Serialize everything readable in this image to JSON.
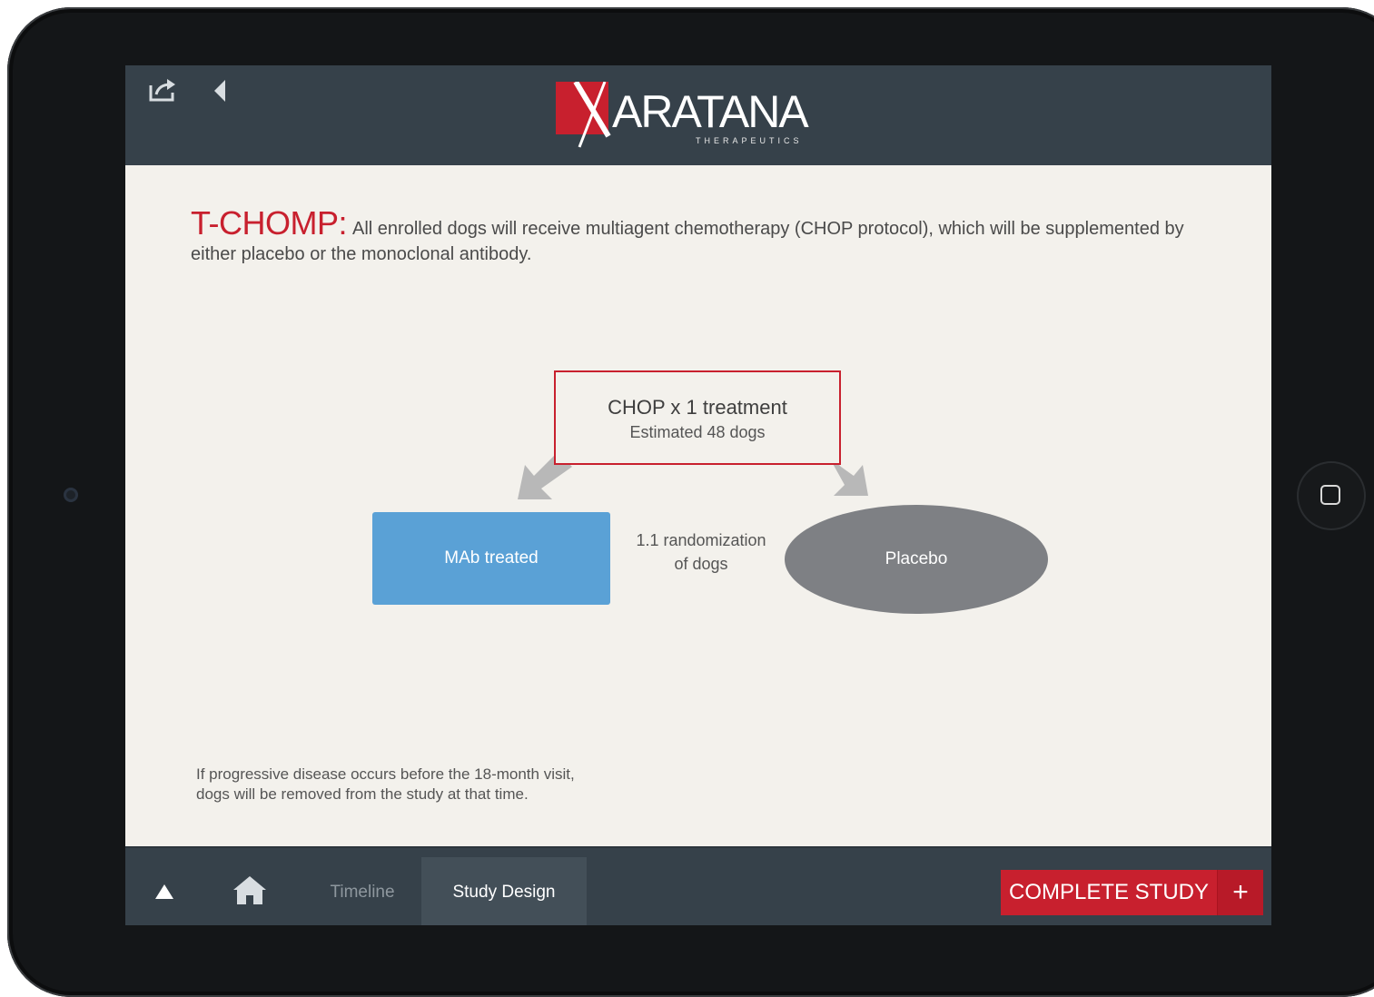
{
  "header": {
    "logo_name": "ARATANA",
    "logo_sub": "THERAPEUTICS"
  },
  "content": {
    "title_highlight": "T-CHOMP:",
    "title_text": "All enrolled dogs will receive multiagent chemotherapy (CHOP protocol), which will be supplemented by either placebo or the monoclonal antibody.",
    "footnote_line1": "If progressive disease occurs before the 18-month visit,",
    "footnote_line2": "dogs will be removed from the study at that time."
  },
  "diagram": {
    "chop_title": "CHOP x 1 treatment",
    "chop_sub": "Estimated 48 dogs",
    "mab_label": "MAb treated",
    "random_line1": "1.1 randomization",
    "random_line2": "of dogs",
    "placebo_label": "Placebo"
  },
  "footer": {
    "timeline_label": "Timeline",
    "study_design_label": "Study Design",
    "complete_label": "COMPLETE STUDY",
    "plus_label": "+"
  },
  "colors": {
    "accent_red": "#c8202e",
    "bar_dark": "#36414a",
    "mab_blue": "#5aa1d6",
    "placebo_gray": "#7e8084"
  }
}
